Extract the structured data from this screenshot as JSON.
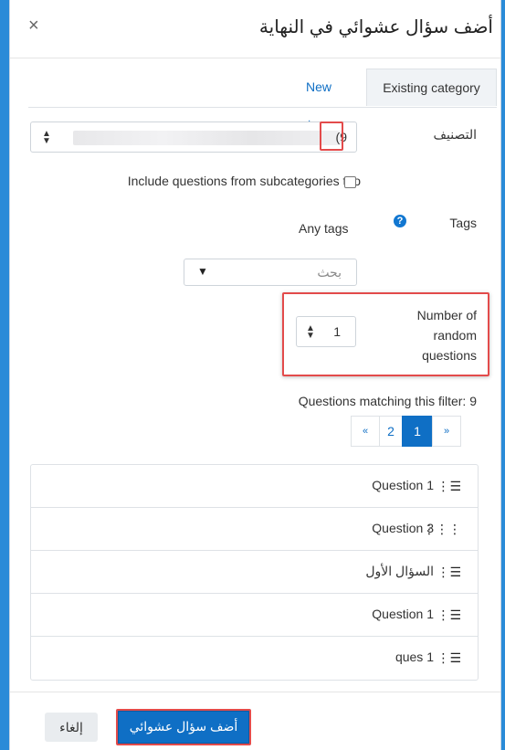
{
  "dialog": {
    "title": "أضف سؤال عشوائي في النهاية",
    "close_glyph": "×"
  },
  "tabs": {
    "existing": "Existing category",
    "new": "New category"
  },
  "form": {
    "category_label": "التصنيف",
    "category_value_suffix": "(9",
    "include_subcategories_label": "Include questions from subcategories too",
    "tags_label": "Tags",
    "help_icon": "?",
    "tags_value": "Any tags",
    "search_placeholder": "بحث",
    "search_arrow": "▼",
    "number_label": "Number of random questions",
    "number_value": "1"
  },
  "results": {
    "matching_text": "Questions matching this filter: 9",
    "pagination": [
      "«",
      "2",
      "1",
      "»"
    ],
    "active_page": "1",
    "questions": [
      {
        "name": "Question 1",
        "icon": "multichoice-icon"
      },
      {
        "name": "Question 3",
        "icon": "matching-icon"
      },
      {
        "name": "السؤال الأول",
        "icon": "multichoice-icon"
      },
      {
        "name": "Question 1",
        "icon": "multichoice-icon"
      },
      {
        "name": "ques 1",
        "icon": "multichoice-icon"
      }
    ]
  },
  "footer": {
    "submit_label": "أضف سؤال عشوائي",
    "cancel_label": "إلغاء"
  },
  "colors": {
    "primary": "#0f6fc5",
    "highlight": "#e34b4b",
    "frame_background": "#2a8bd8"
  }
}
